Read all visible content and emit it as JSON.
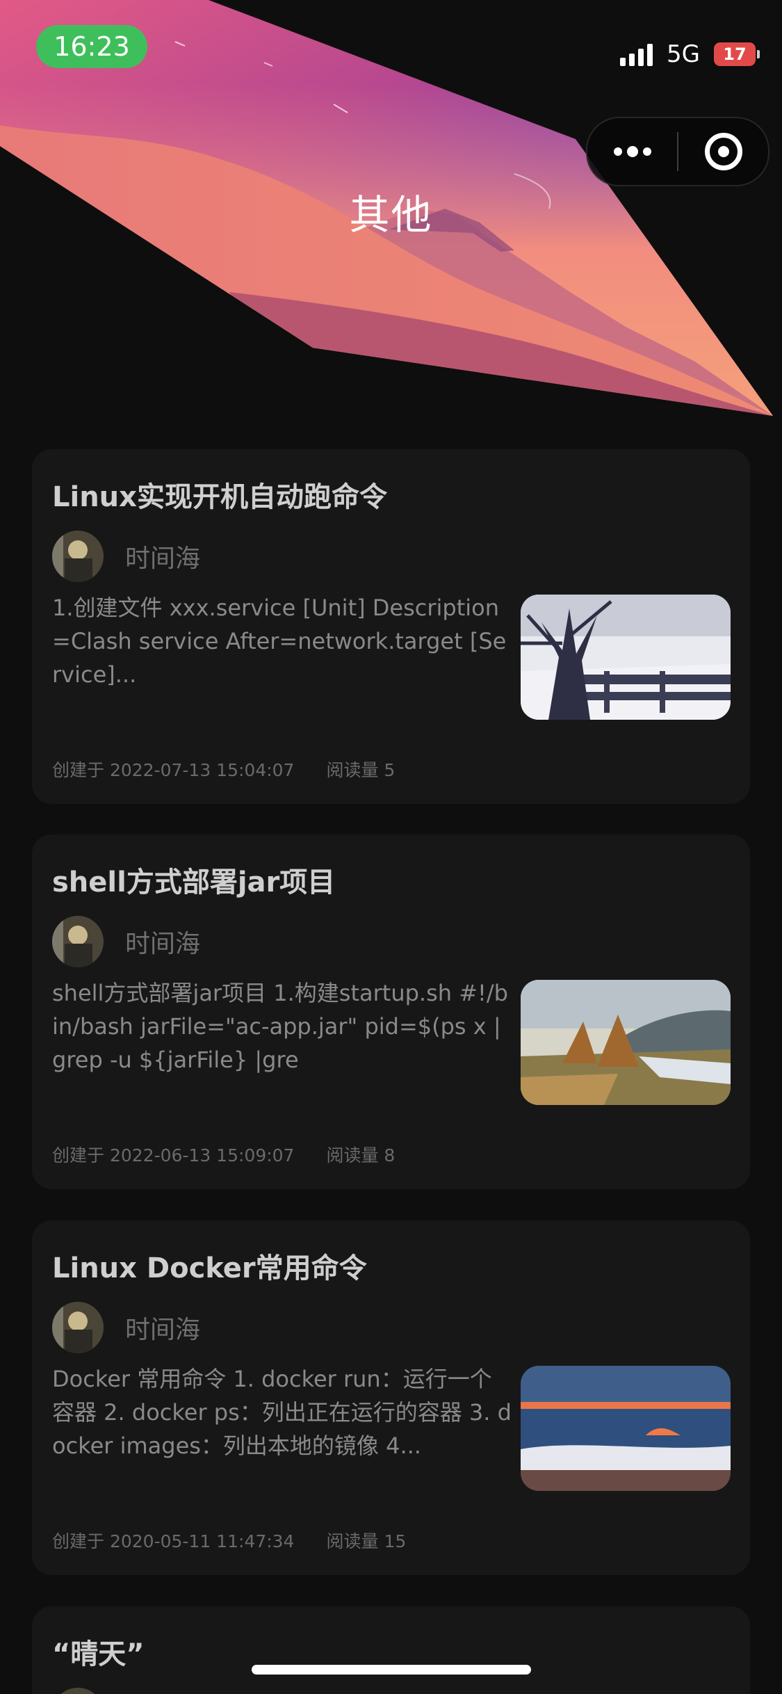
{
  "status_bar": {
    "time": "16:23",
    "network": "5G",
    "battery": "17"
  },
  "header": {
    "title": "其他"
  },
  "capsule": {
    "more_icon": "more-dots-icon",
    "close_icon": "target-icon"
  },
  "articles": [
    {
      "title": "Linux实现开机自动跑命令",
      "author": "时间海",
      "excerpt": "1.创建文件 xxx.service [Unit] Description=Clash service After=network.target [Service]...",
      "created": "创建于 2022-07-13 15:04:07",
      "views": "阅读量 5",
      "thumb": "winter-tree"
    },
    {
      "title": "shell方式部署jar项目",
      "author": "时间海",
      "excerpt": "shell方式部署jar项目 1.构建startup.sh #!/bin/bash jarFile=\"ac-app.jar\" pid=$(ps x |grep -u ${jarFile} |gre",
      "created": "创建于 2022-06-13 15:09:07",
      "views": "阅读量 8",
      "thumb": "autumn-field"
    },
    {
      "title": "Linux Docker常用命令",
      "author": "时间海",
      "excerpt": "Docker 常用命令 1. docker run：运行一个容器 2. docker ps：列出正在运行的容器 3. docker images：列出本地的镜像 4...",
      "created": "创建于 2020-05-11 11:47:34",
      "views": "阅读量 15",
      "thumb": "sea-sunset"
    },
    {
      "title": "“晴天”"
    }
  ],
  "colors": {
    "background": "#0e0e0e",
    "card": "#171717",
    "title_text": "#cfcfcf",
    "time_pill": "#3fbf5b",
    "battery_low": "#e24a4a"
  }
}
